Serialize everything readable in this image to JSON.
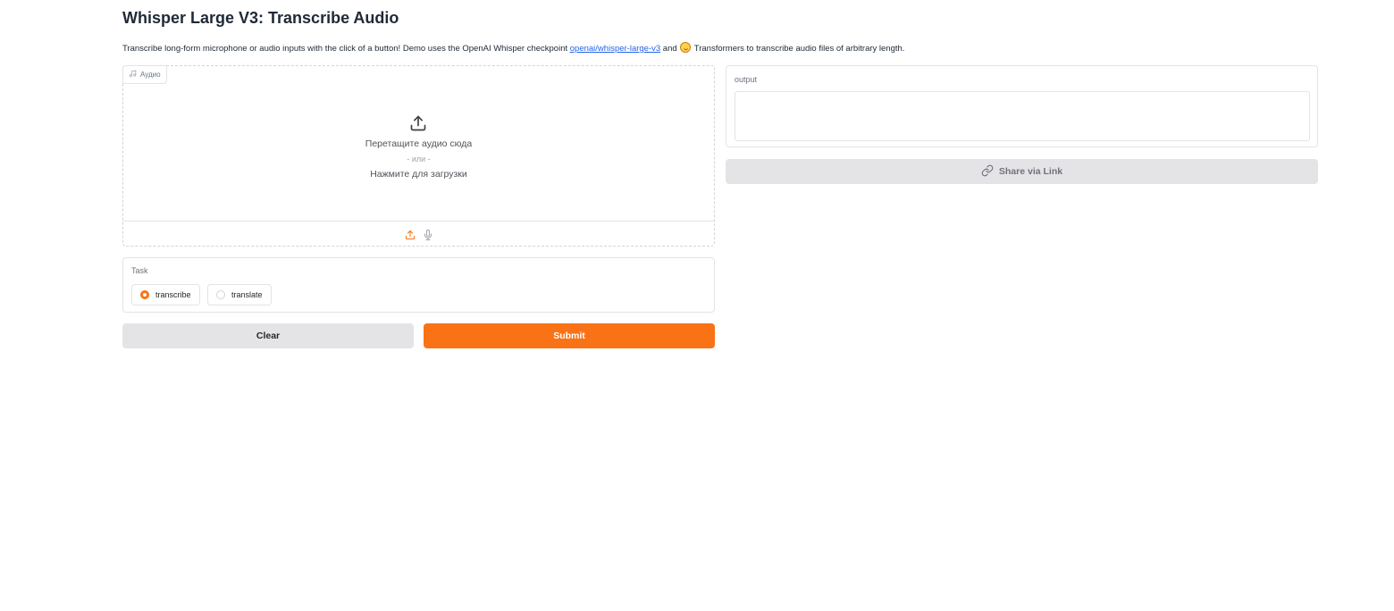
{
  "header": {
    "title": "Whisper Large V3: Transcribe Audio",
    "desc_before_link": "Transcribe long-form microphone or audio inputs with the click of a button! Demo uses the OpenAI Whisper checkpoint ",
    "link_text": "openai/whisper-large-v3",
    "desc_between": " and ",
    "desc_after": " Transformers to transcribe audio files of arbitrary length."
  },
  "audio": {
    "label": "Аудио",
    "label_icon": "music-note-icon",
    "drop_text": "Перетащите аудио сюда",
    "or_text": "- или -",
    "click_text": "Нажмите для загрузки",
    "sources": [
      {
        "icon": "upload-icon",
        "active": true
      },
      {
        "icon": "microphone-icon",
        "active": false
      }
    ]
  },
  "task": {
    "label": "Task",
    "options": [
      {
        "label": "transcribe",
        "selected": true
      },
      {
        "label": "translate",
        "selected": false
      }
    ]
  },
  "buttons": {
    "clear": "Clear",
    "submit": "Submit"
  },
  "output": {
    "label": "output",
    "value": ""
  },
  "share": {
    "label": "Share via Link",
    "icon": "link-icon"
  },
  "colors": {
    "accent": "#f97316",
    "secondary_button": "#e4e4e7",
    "link": "#2563eb"
  }
}
